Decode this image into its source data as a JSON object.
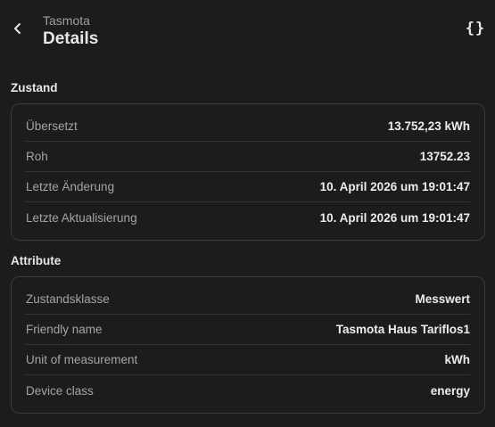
{
  "header": {
    "subtitle": "Tasmota",
    "title": "Details",
    "json_icon_text": "{}"
  },
  "state": {
    "title": "Zustand",
    "rows": [
      {
        "label": "Übersetzt",
        "value": "13.752,23 kWh"
      },
      {
        "label": "Roh",
        "value": "13752.23"
      },
      {
        "label": "Letzte Änderung",
        "value": "10. April 2026 um 19:01:47"
      },
      {
        "label": "Letzte Aktualisierung",
        "value": "10. April 2026 um 19:01:47"
      }
    ]
  },
  "attributes": {
    "title": "Attribute",
    "rows": [
      {
        "label": "Zustandsklasse",
        "value": "Messwert"
      },
      {
        "label": "Friendly name",
        "value": "Tasmota Haus Tariflos1"
      },
      {
        "label": "Unit of measurement",
        "value": "kWh"
      },
      {
        "label": "Device class",
        "value": "energy"
      }
    ]
  }
}
